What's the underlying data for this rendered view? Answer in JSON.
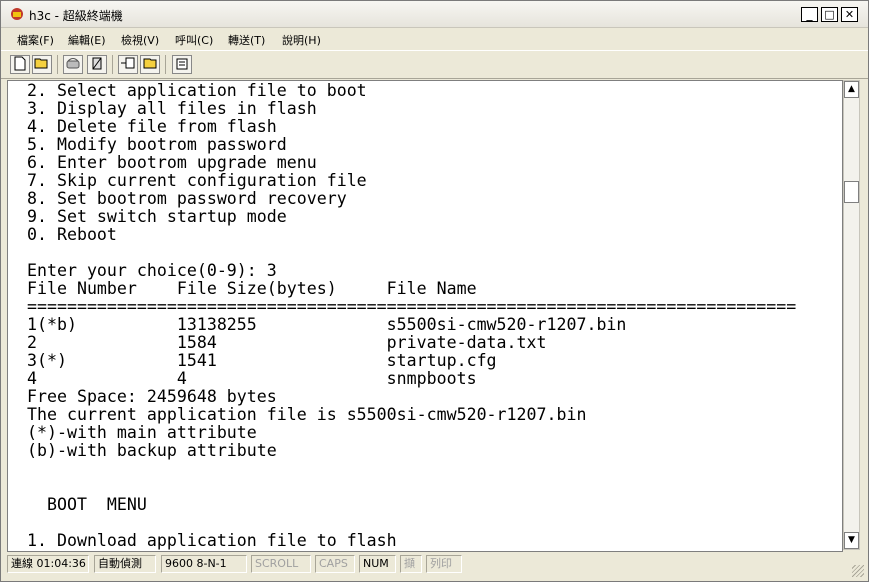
{
  "window": {
    "title": "h3c - 超級終端機",
    "controls": {
      "minimize": "_",
      "maximize": "□",
      "close": "✕"
    }
  },
  "menubar": {
    "items": [
      "檔案(F)",
      "編輯(E)",
      "檢視(V)",
      "呼叫(C)",
      "轉送(T)",
      "說明(H)"
    ]
  },
  "toolbar": {
    "buttons": [
      "new-icon",
      "open-icon",
      "connect-icon",
      "disconnect-icon",
      "send-icon",
      "receive-icon",
      "properties-icon"
    ]
  },
  "terminal": {
    "lines": [
      "2. Select application file to boot",
      "3. Display all files in flash",
      "4. Delete file from flash",
      "5. Modify bootrom password",
      "6. Enter bootrom upgrade menu",
      "7. Skip current configuration file",
      "8. Set bootrom password recovery",
      "9. Set switch startup mode",
      "0. Reboot",
      "",
      "Enter your choice(0-9): 3",
      "File Number    File Size(bytes)     File Name",
      "=============================================================================",
      "1(*b)          13138255             s5500si-cmw520-r1207.bin",
      "2              1584                 private-data.txt",
      "3(*)           1541                 startup.cfg",
      "4              4                    snmpboots",
      "Free Space: 2459648 bytes",
      "The current application file is s5500si-cmw520-r1207.bin",
      "(*)-with main attribute",
      "(b)-with backup attribute",
      "",
      "",
      "  BOOT  MENU",
      "",
      "1. Download application file to flash"
    ]
  },
  "statusbar": {
    "connected": "連線 01:04:36",
    "detect": "自動偵測",
    "port": "9600 8-N-1",
    "scroll": "SCROLL",
    "caps": "CAPS",
    "num": "NUM",
    "capture": "擷",
    "print": "列印"
  }
}
